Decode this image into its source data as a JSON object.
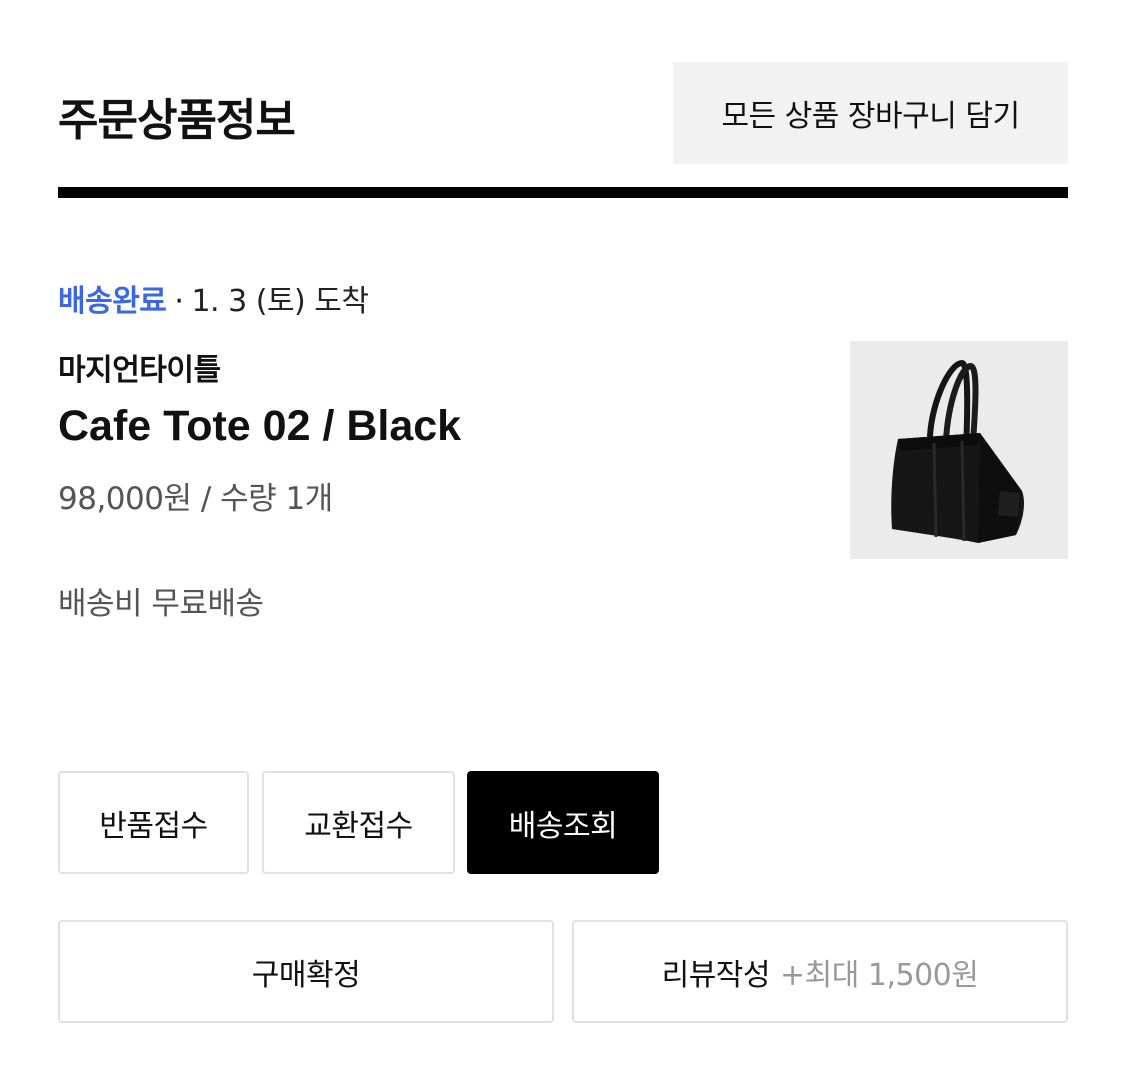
{
  "header": {
    "title": "주문상품정보",
    "add_all_to_cart_label": "모든 상품 장바구니 담기"
  },
  "order_item": {
    "status": "배송완료",
    "separator": "·",
    "arrival": "1. 3 (토) 도착",
    "brand": "마지언타이틀",
    "product_name": "Cafe Tote 02 / Black",
    "price_quantity": "98,000원 / 수량 1개",
    "shipping": "배송비 무료배송",
    "image_icon": "tote-bag-image"
  },
  "actions": {
    "return_label": "반품접수",
    "exchange_label": "교환접수",
    "track_label": "배송조회",
    "confirm_label": "구매확정",
    "review_label": "리뷰작성",
    "review_reward": "+최대 1,500원"
  },
  "colors": {
    "status_blue": "#3b67e4",
    "button_dark": "#000000",
    "header_button_bg": "#f2f2f2"
  }
}
